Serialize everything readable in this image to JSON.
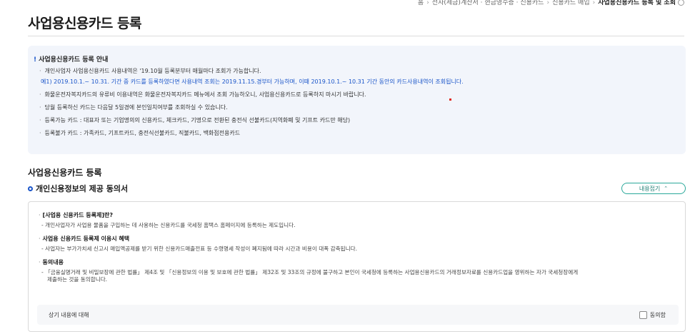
{
  "breadcrumb": {
    "items": [
      "홈",
      "전자(세금)계산서 · 현금영수증 · 신용카드",
      "신용카드 매입",
      "사업용신용카드 등록 및 조회"
    ]
  },
  "page": {
    "title": "사업용신용카드 등록"
  },
  "notice": {
    "title": "사업용신용카드 등록 안내",
    "lines": [
      "개인사업자 사업용신용카드 사용내역은 '19.10월 등록분부터 매월마다 조회가 가능합니다.",
      "예1) 2019.10.1.~ 10.31. 기간 중 카드를 등록하였다면 사용내역 조회는 2019.11.15.경부터 가능하며, 이때 2019.10.1.~ 10.31 기간 동안의 카드사용내역이 조회됩니다.",
      "화물운전자복지카드의 유류비 이용내역은 화물운전자복지카드 메뉴에서 조회 가능하오니, 사업용신용카드로 등록하지 마시기 바랍니다.",
      "당월 등록하신 카드는 다음달 5일경에 본인일치여부를 조회하실 수 있습니다.",
      "등록가능 카드 : 대표자 또는 기업명의의 신용카드, 체크카드, 기명으로 전환된 충전식 선불카드(지역화폐 및 기프트 카드만 해당)",
      "등록불가 카드 : 가족카드, 기프트카드, 충전식선불카드, 직불카드, 백화점전용카드"
    ]
  },
  "section": {
    "title": "사업용신용카드 등록",
    "subtitle": "개인신용정보의 제공 동의서",
    "collapse_label": "내용접기"
  },
  "consent": {
    "blocks": [
      {
        "head": "[사업용 신용카드 등록제]란?",
        "body": [
          "- 개인사업자가 사업용 물품을 구입하는 데 사용하는 신용카드를 국세청 홈택스 홈페이지에 등록하는 제도입니다."
        ]
      },
      {
        "head": "사업용 신용카드 등록제 이용시 혜택",
        "body": [
          "- 사업자는 부가가치세 신고시 매입액공제를 받기 위한 신용카드매출전표 등 수령명세 작성이 폐지됨에 따라 시간과 비용이 대폭 감축됩니다."
        ]
      },
      {
        "head": "동의내용",
        "body": [
          "- 「금융실명거래 및 비밀보장에 관한 법률」 제4조 및 「신용정보의 이용 및 보호에 관한 법률」 제32조 및 33조의 규정에 불구하고 본인이 국세청에 등록하는 사업용신용카드의   거래정보자료를 신용카드업을 영위하는 자가 국세청장에게",
          "제출하는 것을 동의합니다."
        ]
      }
    ],
    "agree_prompt": "상기 내용에 대해",
    "agree_label": "동의함",
    "agreed": false
  },
  "colors": {
    "accent": "#1a55c9",
    "button_border": "#2aa89a",
    "notice_bg": "#f2f5fb"
  }
}
